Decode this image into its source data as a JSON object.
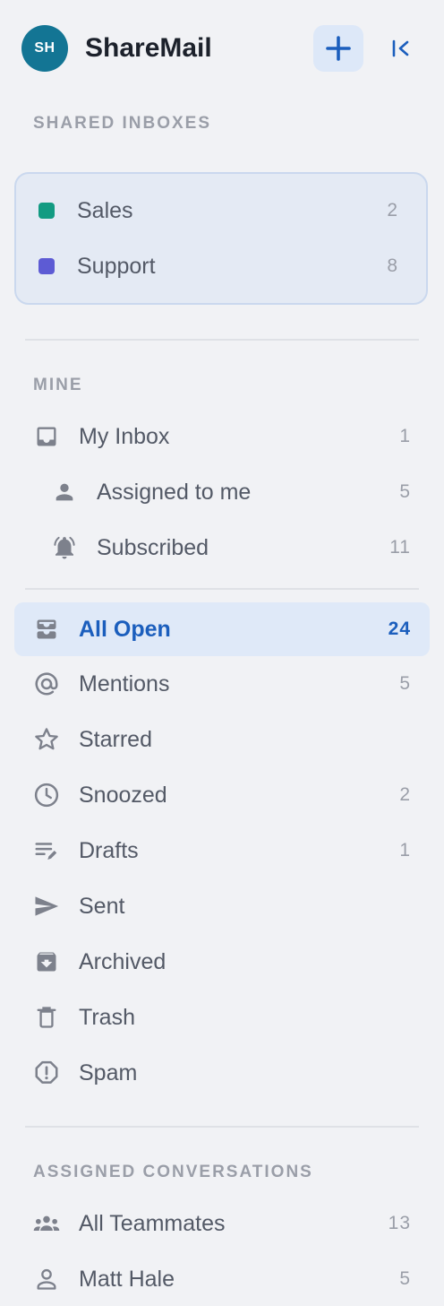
{
  "app": {
    "avatar_initials": "SH",
    "title": "ShareMail",
    "brand_color": "#137594",
    "accent_color": "#1b5ebd"
  },
  "shared": {
    "title": "SHARED INBOXES",
    "items": [
      {
        "label": "Sales",
        "count": "2",
        "color": "#129b82"
      },
      {
        "label": "Support",
        "count": "8",
        "color": "#5d5bd4"
      }
    ]
  },
  "mine": {
    "title": "MINE",
    "items": [
      {
        "label": "My Inbox",
        "count": "1",
        "icon": "inbox-icon"
      },
      {
        "label": "Assigned to me",
        "count": "5",
        "icon": "person-icon"
      },
      {
        "label": "Subscribed",
        "count": "11",
        "icon": "bell-icon"
      }
    ]
  },
  "folders": {
    "items": [
      {
        "label": "All Open",
        "count": "24",
        "icon": "all-inbox-icon",
        "active": true
      },
      {
        "label": "Mentions",
        "count": "5",
        "icon": "at-icon"
      },
      {
        "label": "Starred",
        "count": "",
        "icon": "star-icon"
      },
      {
        "label": "Snoozed",
        "count": "2",
        "icon": "clock-icon"
      },
      {
        "label": "Drafts",
        "count": "1",
        "icon": "drafts-icon"
      },
      {
        "label": "Sent",
        "count": "",
        "icon": "send-icon"
      },
      {
        "label": "Archived",
        "count": "",
        "icon": "archive-icon"
      },
      {
        "label": "Trash",
        "count": "",
        "icon": "trash-icon"
      },
      {
        "label": "Spam",
        "count": "",
        "icon": "spam-icon"
      }
    ]
  },
  "assigned": {
    "title": "ASSIGNED CONVERSATIONS",
    "items": [
      {
        "label": "All Teammates",
        "count": "13",
        "icon": "group-icon"
      },
      {
        "label": "Matt Hale",
        "count": "5",
        "icon": "user-outline-icon"
      }
    ]
  }
}
